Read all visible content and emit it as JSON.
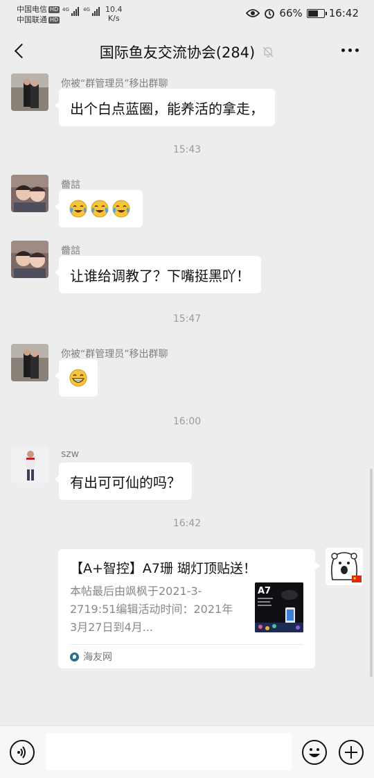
{
  "status_bar": {
    "carrier1": "中国电信",
    "carrier2": "中国联通",
    "hd_badge": "HD",
    "network": "4G",
    "net_speed_value": "10.4",
    "net_speed_unit": "K/s",
    "battery": "66%",
    "battery_level": 0.66,
    "time": "16:42"
  },
  "header": {
    "title": "国际鱼友交流协会(284)"
  },
  "messages": [
    {
      "sender": "你被“群管理员”移出群聊",
      "text": "出个白点蓝圈，能养活的拿走，"
    },
    {
      "time": "15:43"
    },
    {
      "sender": "齤誩",
      "emojis": [
        "face-with-tears-of-joy",
        "face-with-tears-of-joy",
        "face-with-tears-of-joy"
      ]
    },
    {
      "sender": "齤誩",
      "text": "让谁给调教了？下嘴挺黑吖！"
    },
    {
      "time": "15:47"
    },
    {
      "sender": "你被“群管理员”移出群聊",
      "emojis": [
        "grinning-face"
      ]
    },
    {
      "time": "16:00"
    },
    {
      "sender": "szw",
      "text": "有出可可仙的吗？"
    },
    {
      "time": "16:42"
    }
  ],
  "link_card": {
    "title": "【A+智控】A7珊 瑚灯顶贴送！",
    "description": "本帖最后由飒枫于2021-3-2719:51编辑活动时间：2021年3月27日到4月...",
    "thumb_label": "A7",
    "source": "海友网"
  },
  "icons": {
    "back": "back-arrow-icon",
    "mute": "bell-off-icon",
    "more": "more-dots-icon",
    "voice": "voice-icon",
    "emoji": "emoji-icon",
    "plus": "plus-icon",
    "source": "haiyou-logo-icon"
  },
  "colors": {
    "background": "#ededed",
    "bubble": "#ffffff",
    "timestamp": "#9b9b9b",
    "sender": "#7f7f7f"
  }
}
